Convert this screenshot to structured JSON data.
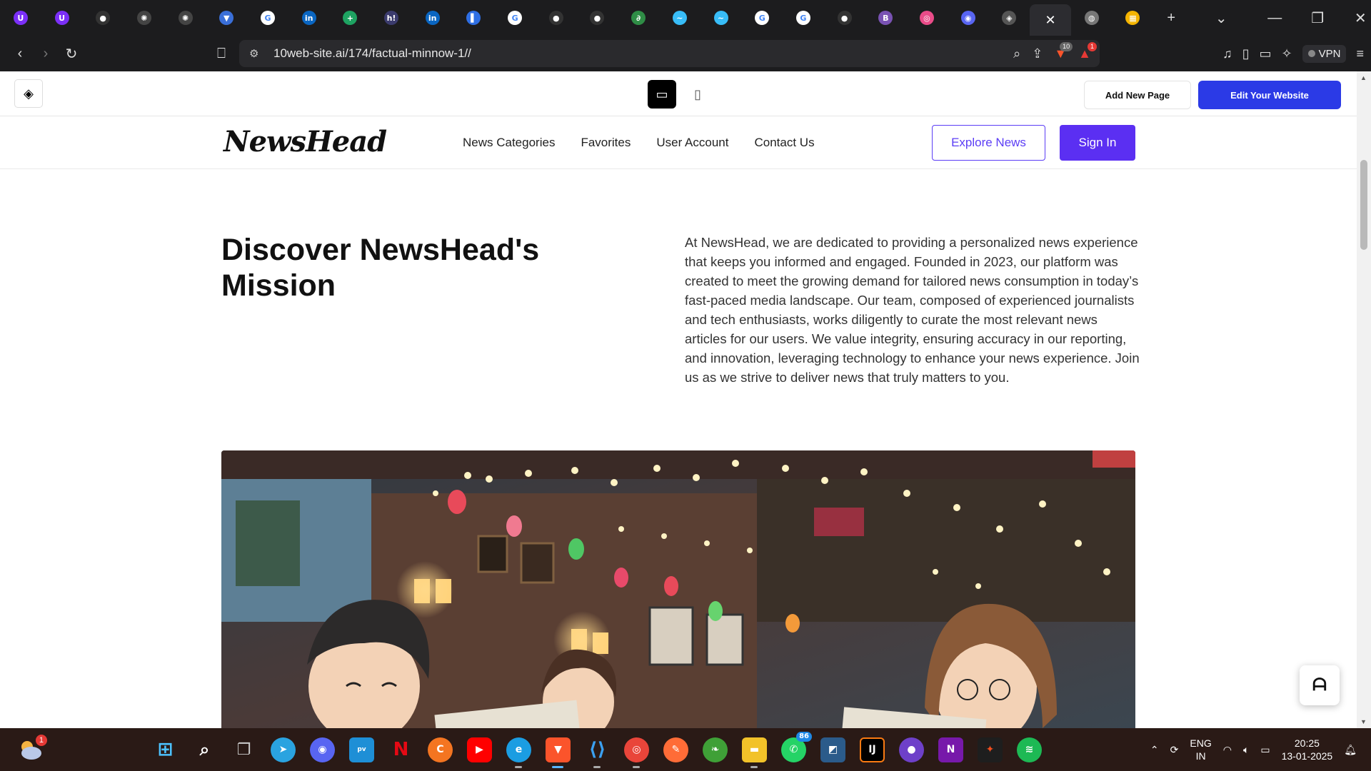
{
  "browser": {
    "tabs": [
      {
        "icon": "ublock-icon",
        "color": "#7b2ff7",
        "glyph": "U"
      },
      {
        "icon": "ublock-icon",
        "color": "#7b2ff7",
        "glyph": "U"
      },
      {
        "icon": "github-icon",
        "color": "#333333",
        "glyph": "●"
      },
      {
        "icon": "openai-icon",
        "color": "#444444",
        "glyph": "✺"
      },
      {
        "icon": "openai-icon",
        "color": "#444444",
        "glyph": "✺"
      },
      {
        "icon": "shield-icon",
        "color": "#3a6fd8",
        "glyph": "▼"
      },
      {
        "icon": "google-icon",
        "color": "#ffffff",
        "glyph": "G"
      },
      {
        "icon": "linkedin-icon",
        "color": "#0a66c2",
        "glyph": "in"
      },
      {
        "icon": "sheets-plus-icon",
        "color": "#1ea362",
        "glyph": "+"
      },
      {
        "icon": "hackerrank-icon",
        "color": "#3b3b6d",
        "glyph": "h!"
      },
      {
        "icon": "linkedin-icon",
        "color": "#0a66c2",
        "glyph": "in"
      },
      {
        "icon": "sidebar-app-icon",
        "color": "#2f6fe4",
        "glyph": "▌"
      },
      {
        "icon": "google-icon",
        "color": "#ffffff",
        "glyph": "G"
      },
      {
        "icon": "github-icon",
        "color": "#333333",
        "glyph": "●"
      },
      {
        "icon": "github-icon",
        "color": "#333333",
        "glyph": "●"
      },
      {
        "icon": "geeksforgeeks-icon",
        "color": "#2f8d46",
        "glyph": "∂"
      },
      {
        "icon": "tailwind-icon",
        "color": "#38bdf8",
        "glyph": "~"
      },
      {
        "icon": "tailwind-icon",
        "color": "#38bdf8",
        "glyph": "~"
      },
      {
        "icon": "google-icon",
        "color": "#ffffff",
        "glyph": "G"
      },
      {
        "icon": "google-icon",
        "color": "#ffffff",
        "glyph": "G"
      },
      {
        "icon": "github-icon",
        "color": "#333333",
        "glyph": "●"
      },
      {
        "icon": "bootstrap-icon",
        "color": "#7952b3",
        "glyph": "B"
      },
      {
        "icon": "dribbble-icon",
        "color": "#ea4c89",
        "glyph": "◎"
      },
      {
        "icon": "discord-like-icon",
        "color": "#5865f2",
        "glyph": "◉"
      },
      {
        "icon": "10web-icon",
        "color": "#555555",
        "glyph": "◈"
      }
    ],
    "active_tab_close": "✕",
    "tabs_after": [
      {
        "icon": "globe-icon",
        "color": "#777777",
        "glyph": "◍"
      },
      {
        "icon": "colorful-app-icon",
        "color": "#f4b400",
        "glyph": "▦"
      }
    ],
    "new_tab": "+",
    "url": "10web-site.ai/174/factual-minnow-1//",
    "vpn_label": "VPN",
    "brave_badge": "10",
    "alert_badge": "1"
  },
  "editor": {
    "add_page": "Add New Page",
    "edit_site": "Edit Your Website"
  },
  "site": {
    "brand": "NewsHead",
    "nav": [
      "News Categories",
      "Favorites",
      "User Account",
      "Contact Us"
    ],
    "explore": "Explore News",
    "signin": "Sign In",
    "hero_title": "Discover NewsHead's Mission",
    "hero_text": "At NewsHead, we are dedicated to providing a personalized news experience that keeps you informed and engaged. Founded in 2023, our platform was created to meet the growing demand for tailored news consumption in today’s fast-paced media landscape. Our team, composed of experienced journalists and tech enthusiasts, works diligently to curate the most relevant news articles for our users. We value integrity, ensuring accuracy in our reporting, and innovation, leveraging technology to enhance your news experience. Join us as we strive to deliver news that truly matters to you."
  },
  "taskbar": {
    "weather_badge": "1",
    "whatsapp_count": "86",
    "lang_line1": "ENG",
    "lang_line2": "IN",
    "time": "20:25",
    "date": "13-01-2025"
  },
  "colors": {
    "accent": "#5b2ff2",
    "editor_blue": "#2b3ae6"
  }
}
